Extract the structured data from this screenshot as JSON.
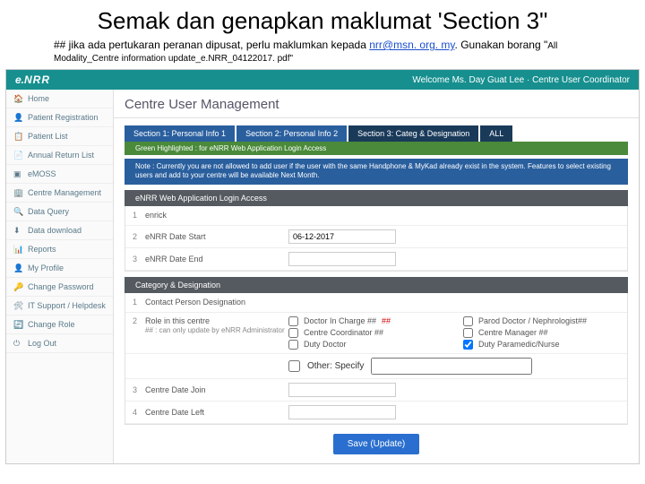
{
  "slide": {
    "title": "Semak dan genapkan maklumat 'Section 3\"",
    "note_prefix": "## jika ada pertukaran peranan dipusat, perlu maklumkan kepada ",
    "note_link_text": "nrr@msn. org. my",
    "note_suffix": ". Gunakan borang \"",
    "note_small": "All Modality_Centre information update_e.NRR_04122017. pdf\""
  },
  "topbar": {
    "logo_e": "e.",
    "logo_nrr": "NRR",
    "welcome": "Welcome Ms. Day Guat Lee · Centre User Coordinator"
  },
  "sidebar": {
    "items": [
      {
        "label": "Home"
      },
      {
        "label": "Patient Registration"
      },
      {
        "label": "Patient List"
      },
      {
        "label": "Annual Return List"
      },
      {
        "label": "eMOSS"
      },
      {
        "label": "Centre Management"
      },
      {
        "label": "Data Query"
      },
      {
        "label": "Data download"
      },
      {
        "label": "Reports"
      },
      {
        "label": "My Profile"
      },
      {
        "label": "Change Password"
      },
      {
        "label": "IT Support / Helpdesk"
      },
      {
        "label": "Change Role"
      },
      {
        "label": "Log Out"
      }
    ]
  },
  "page": {
    "heading": "Centre User Management",
    "tabs": [
      {
        "label": "Section 1: Personal Info 1"
      },
      {
        "label": "Section 2: Personal Info 2"
      },
      {
        "label": "Section 3: Categ & Designation"
      },
      {
        "label": "ALL"
      }
    ],
    "green_hint": "Green Highlighted : for eNRR Web Application Login Access",
    "note": "Note : Currently you are not allowed to add user if the user with the same Handphone & MyKad already exist in the system. Features to select existing users and add to your centre will be available Next Month."
  },
  "sections": {
    "login": {
      "title": "eNRR Web Application Login Access",
      "rows": [
        {
          "n": "1",
          "label": "enrick",
          "value": ""
        },
        {
          "n": "2",
          "label": "eNRR Date Start",
          "value": "06-12-2017"
        },
        {
          "n": "3",
          "label": "eNRR Date End",
          "value": ""
        }
      ]
    },
    "category": {
      "title": "Category & Designation",
      "row1": {
        "n": "1",
        "label": "Contact Person Designation"
      },
      "row2": {
        "n": "2",
        "label": "Role in this centre",
        "hint": "## : can only update by eNRR Administrator"
      },
      "roles": [
        {
          "label": "Doctor In Charge ##",
          "checked": false
        },
        {
          "label": "Parod Doctor / Nephrologist##",
          "checked": false
        },
        {
          "label": "Centre Coordinator ##",
          "checked": false
        },
        {
          "label": "Centre Manager ##",
          "checked": false
        },
        {
          "label": "Duty Doctor",
          "checked": false
        },
        {
          "label": "Duty Paramedic/Nurse",
          "checked": true
        }
      ],
      "other_label": "Other: Specify",
      "row3": {
        "n": "3",
        "label": "Centre Date Join"
      },
      "row4": {
        "n": "4",
        "label": "Centre Date Left"
      }
    }
  },
  "button": {
    "save": "Save (Update)"
  }
}
